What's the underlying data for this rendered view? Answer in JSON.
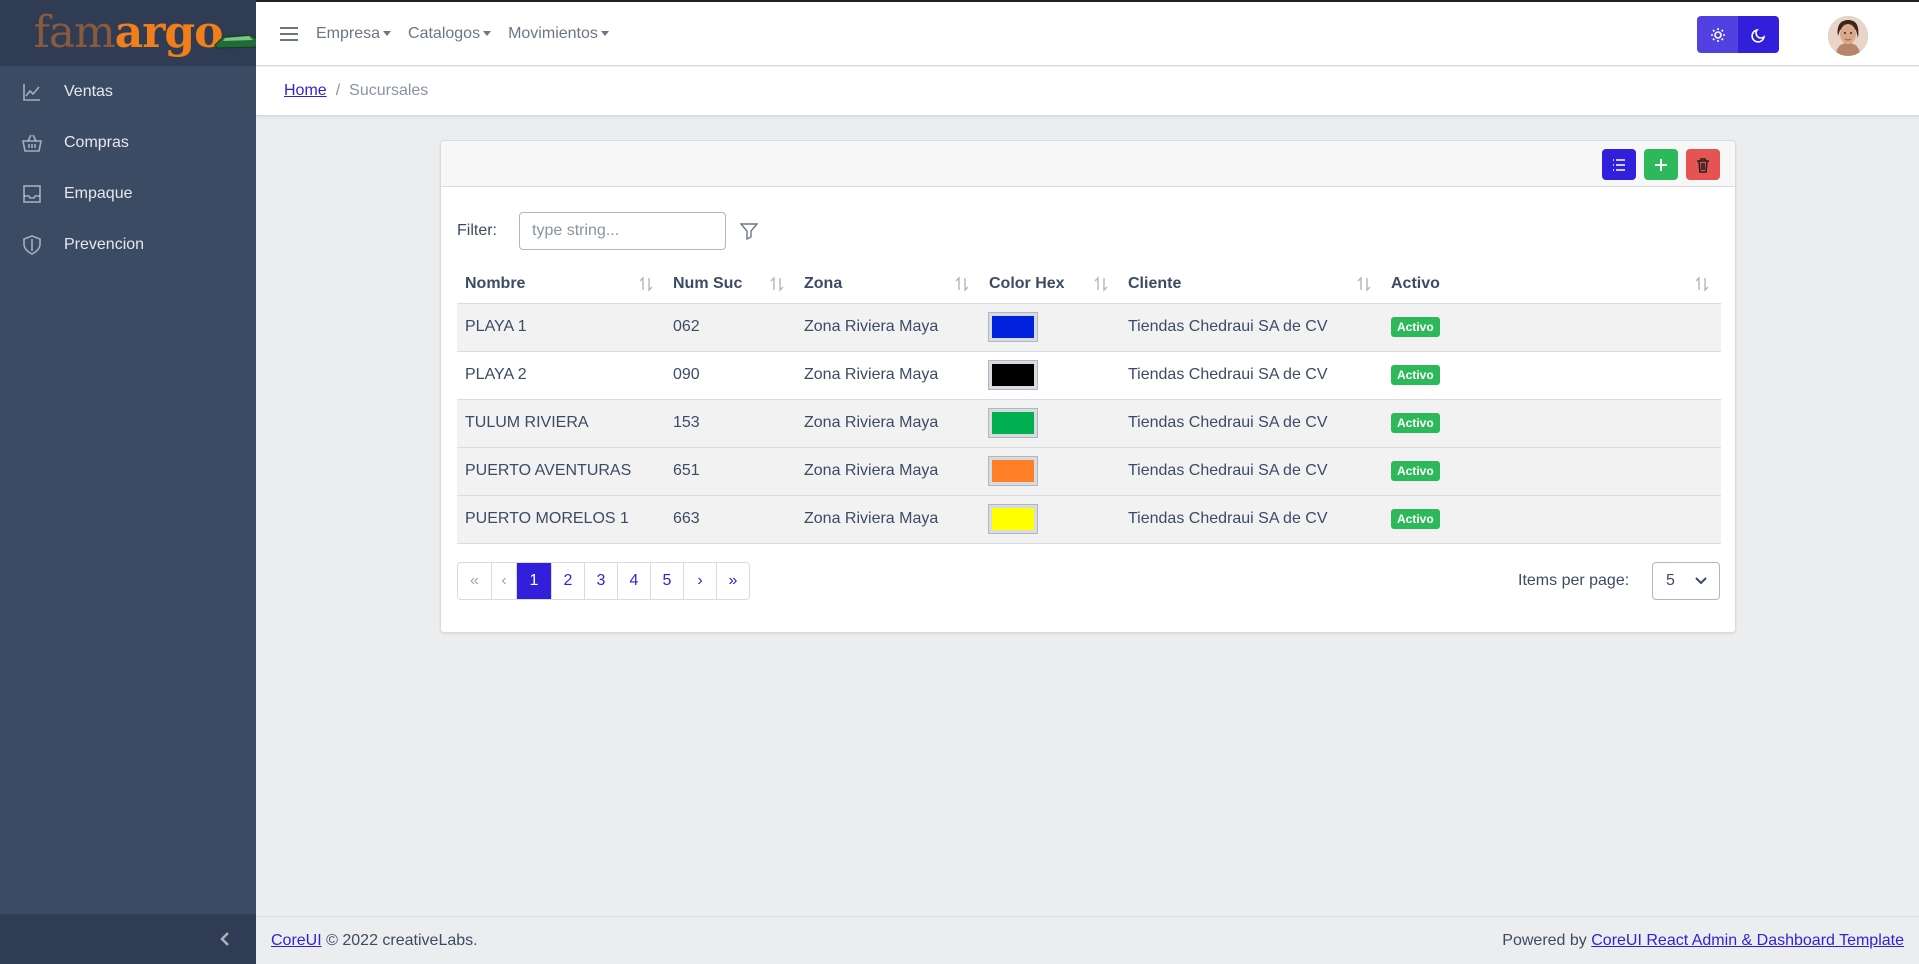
{
  "brand": {
    "logo_part1": "fam",
    "logo_part2": "argo"
  },
  "sidebar": {
    "items": [
      {
        "label": "Ventas",
        "icon": "chart-line-icon"
      },
      {
        "label": "Compras",
        "icon": "basket-icon"
      },
      {
        "label": "Empaque",
        "icon": "inbox-icon"
      },
      {
        "label": "Prevencion",
        "icon": "shield-icon"
      }
    ]
  },
  "header": {
    "menus": [
      "Empresa",
      "Catalogos",
      "Movimientos"
    ]
  },
  "breadcrumb": {
    "home": "Home",
    "current": "Sucursales"
  },
  "filter": {
    "label": "Filter:",
    "placeholder": "type string..."
  },
  "table": {
    "columns": [
      "Nombre",
      "Num Suc",
      "Zona",
      "Color Hex",
      "Cliente",
      "Activo"
    ],
    "rows": [
      {
        "nombre": "PLAYA 1",
        "num": "062",
        "zona": "Zona Riviera Maya",
        "color": "#0022dd",
        "cliente": "Tiendas Chedraui SA de CV",
        "activo": "Activo"
      },
      {
        "nombre": "PLAYA 2",
        "num": "090",
        "zona": "Zona Riviera Maya",
        "color": "#000000",
        "cliente": "Tiendas Chedraui SA de CV",
        "activo": "Activo"
      },
      {
        "nombre": "TULUM RIVIERA",
        "num": "153",
        "zona": "Zona Riviera Maya",
        "color": "#00b050",
        "cliente": "Tiendas Chedraui SA de CV",
        "activo": "Activo"
      },
      {
        "nombre": "PUERTO AVENTURAS",
        "num": "651",
        "zona": "Zona Riviera Maya",
        "color": "#ff7f27",
        "cliente": "Tiendas Chedraui SA de CV",
        "activo": "Activo"
      },
      {
        "nombre": "PUERTO MORELOS 1",
        "num": "663",
        "zona": "Zona Riviera Maya",
        "color": "#ffff00",
        "cliente": "Tiendas Chedraui SA de CV",
        "activo": "Activo"
      }
    ]
  },
  "pagination": {
    "first": "«",
    "prev": "‹",
    "next": "›",
    "last": "»",
    "pages": [
      "1",
      "2",
      "3",
      "4",
      "5"
    ],
    "active": "1"
  },
  "items_per_page": {
    "label": "Items per page:",
    "value": "5"
  },
  "footer": {
    "left_link": "CoreUI",
    "left_text": "© 2022 creativeLabs.",
    "right_text": "Powered by",
    "right_link": "CoreUI React Admin & Dashboard Template"
  },
  "colors": {
    "primary": "#321fdb",
    "success": "#2eb85c",
    "danger": "#e55353",
    "sidebar": "#3c4b64"
  }
}
